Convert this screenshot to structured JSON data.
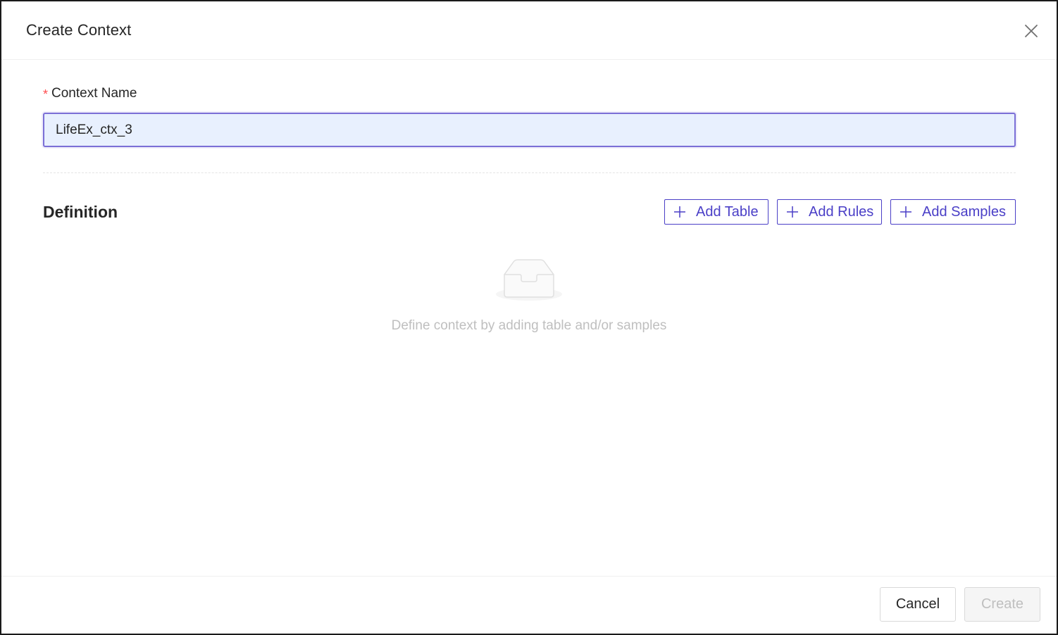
{
  "dialog": {
    "title": "Create Context"
  },
  "form": {
    "required_mark": "*",
    "name_label": "Context Name",
    "name_value": "LifeEx_ctx_3"
  },
  "definition": {
    "title": "Definition",
    "buttons": [
      {
        "label": "Add Table",
        "icon": "plus-icon"
      },
      {
        "label": "Add Rules",
        "icon": "plus-icon"
      },
      {
        "label": "Add Samples",
        "icon": "plus-icon"
      }
    ],
    "empty_icon": "empty-inbox-icon",
    "empty_text": "Define context by adding table and/or samples"
  },
  "footer": {
    "cancel_label": "Cancel",
    "create_label": "Create",
    "create_disabled": true
  },
  "colors": {
    "accent": "#4a3fc7",
    "input_focus_border": "#7b6fd6",
    "input_autofill_bg": "#e8f0fe",
    "required": "#ff4d4f",
    "placeholder_text": "#bfbfbf"
  }
}
